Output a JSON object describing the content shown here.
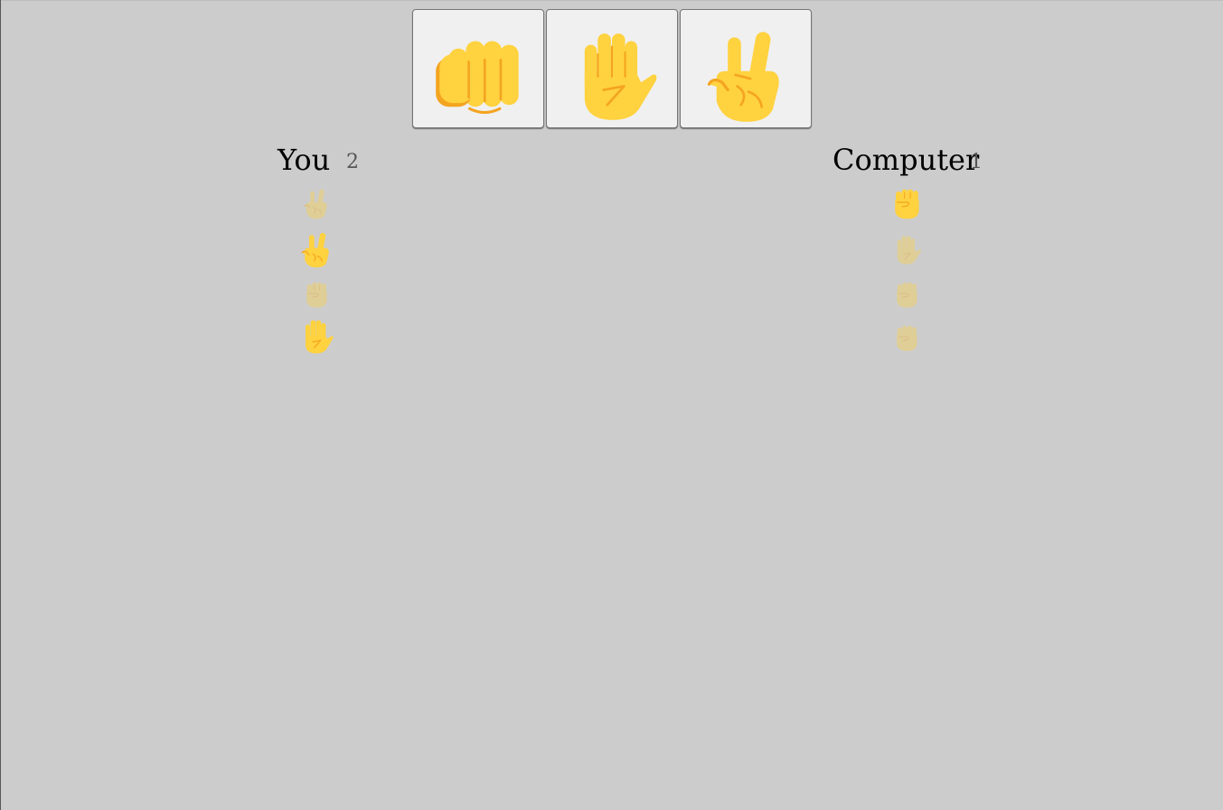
{
  "choices": [
    {
      "id": "rock",
      "icon": "oncoming-fist-icon"
    },
    {
      "id": "paper",
      "icon": "raised-hand-icon"
    },
    {
      "id": "scissors",
      "icon": "victory-hand-icon"
    }
  ],
  "player": {
    "name": "You",
    "score": "2",
    "history": [
      {
        "move": "scissors",
        "icon": "victory-hand-icon",
        "result": "faded"
      },
      {
        "move": "scissors",
        "icon": "victory-hand-icon",
        "result": "win"
      },
      {
        "move": "rock",
        "icon": "raised-fist-icon",
        "result": "faded"
      },
      {
        "move": "paper",
        "icon": "raised-hand-icon",
        "result": "win"
      }
    ]
  },
  "computer": {
    "name": "Computer",
    "score": "1",
    "history": [
      {
        "move": "rock",
        "icon": "raised-fist-icon",
        "result": "win"
      },
      {
        "move": "paper",
        "icon": "raised-hand-icon",
        "result": "faded"
      },
      {
        "move": "rock",
        "icon": "raised-fist-icon",
        "result": "faded"
      },
      {
        "move": "rock",
        "icon": "raised-fist-icon",
        "result": "faded"
      }
    ]
  },
  "colors": {
    "background": "#cccccc",
    "button_bg": "#f0f0f0",
    "skin": "#ffd23f",
    "skin_shadow": "#f4a421",
    "score_text": "#555555"
  }
}
